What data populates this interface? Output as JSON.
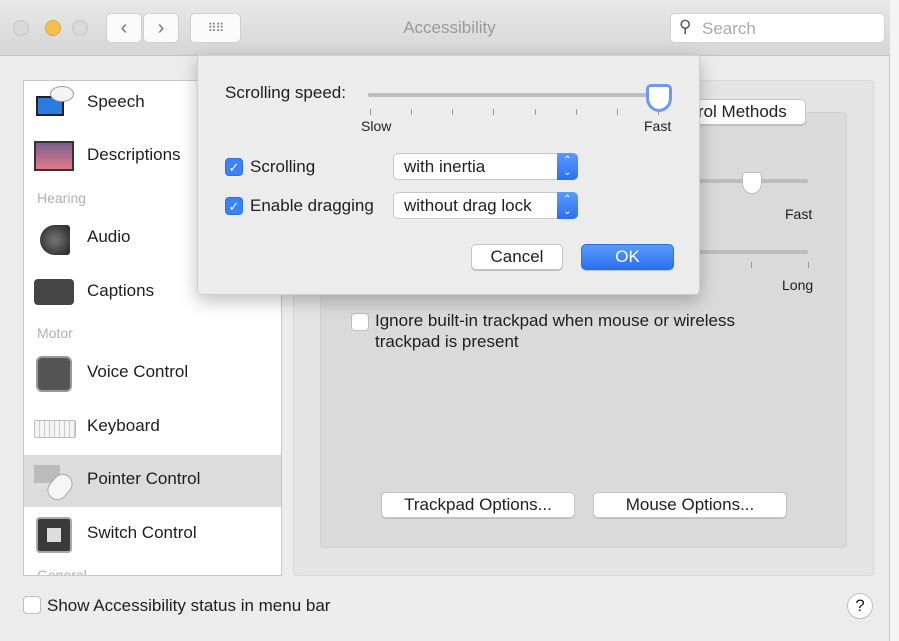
{
  "window": {
    "title": "Accessibility",
    "search_placeholder": "Search"
  },
  "sidebar": {
    "items": [
      {
        "label": "Speech",
        "icon": "speech-icon"
      },
      {
        "label": "Descriptions",
        "icon": "descriptions-icon"
      },
      {
        "label": "Audio",
        "icon": "speaker-icon"
      },
      {
        "label": "Captions",
        "icon": "captions-icon"
      },
      {
        "label": "Voice Control",
        "icon": "voice-control-icon"
      },
      {
        "label": "Keyboard",
        "icon": "keyboard-icon"
      },
      {
        "label": "Pointer Control",
        "icon": "pointer-control-icon",
        "selected": true
      },
      {
        "label": "Switch Control",
        "icon": "switch-control-icon"
      }
    ],
    "headers": [
      "Hearing",
      "Motor",
      "General"
    ]
  },
  "main": {
    "alt_methods_button": "Alternate Control Methods",
    "slider1_max_label": "Fast",
    "slider2_max_label": "Long",
    "ignore_trackpad_label_line1": "Ignore built-in trackpad when mouse or wireless",
    "ignore_trackpad_label_line2": "trackpad is present",
    "ignore_trackpad_checked": false,
    "trackpad_options_button": "Trackpad Options...",
    "mouse_options_button": "Mouse Options..."
  },
  "footer": {
    "status_menu_label": "Show Accessibility status in menu bar",
    "status_menu_checked": false,
    "help": "?"
  },
  "popover": {
    "scrolling_speed_label": "Scrolling speed:",
    "scrolling_speed_value": 1.0,
    "slow_label": "Slow",
    "fast_label": "Fast",
    "scrolling_label": "Scrolling",
    "scrolling_checked": true,
    "scrolling_value": "with inertia",
    "dragging_label": "Enable dragging",
    "dragging_checked": true,
    "dragging_value": "without drag lock",
    "cancel": "Cancel",
    "ok": "OK"
  },
  "colors": {
    "accent": "#3b82f6",
    "close_light": "#d9d9d9",
    "minimize_light": "#f5bf4f"
  }
}
